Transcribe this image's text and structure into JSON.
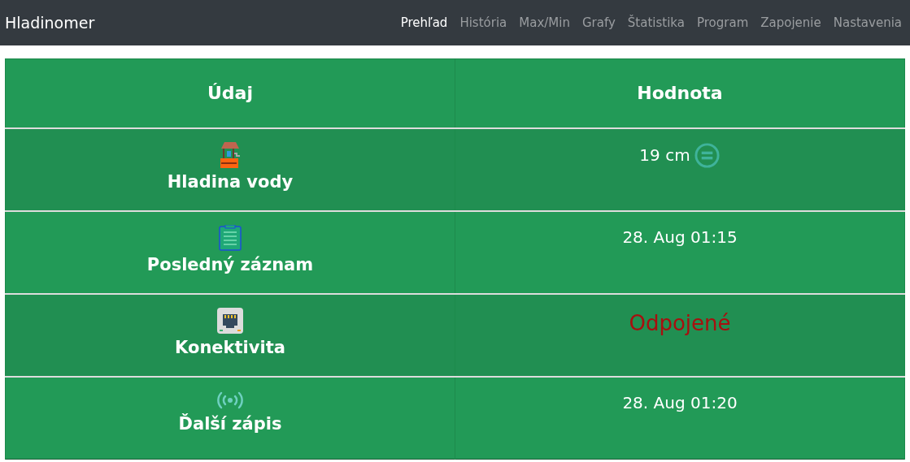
{
  "navbar": {
    "brand": "Hladinomer",
    "links": [
      {
        "label": "Prehľad",
        "selected": true
      },
      {
        "label": "História",
        "selected": false
      },
      {
        "label": "Max/Min",
        "selected": false
      },
      {
        "label": "Grafy",
        "selected": false
      },
      {
        "label": "Štatistika",
        "selected": false
      },
      {
        "label": "Program",
        "selected": false
      },
      {
        "label": "Zapojenie",
        "selected": false
      },
      {
        "label": "Nastavenia",
        "selected": false
      }
    ]
  },
  "table": {
    "columns": [
      "Údaj",
      "Hodnota"
    ],
    "rows": [
      {
        "kind": "level",
        "label": "Hladina vody",
        "value": "19 cm",
        "alert": false
      },
      {
        "kind": "record",
        "label": "Posledný záznam",
        "value": "28. Aug 01:15",
        "alert": false
      },
      {
        "kind": "network",
        "label": "Konektivita",
        "value": "Odpojené",
        "alert": true
      },
      {
        "kind": "schedule",
        "label": "Ďalší zápis",
        "value": "28. Aug 01:20",
        "alert": false
      }
    ]
  }
}
